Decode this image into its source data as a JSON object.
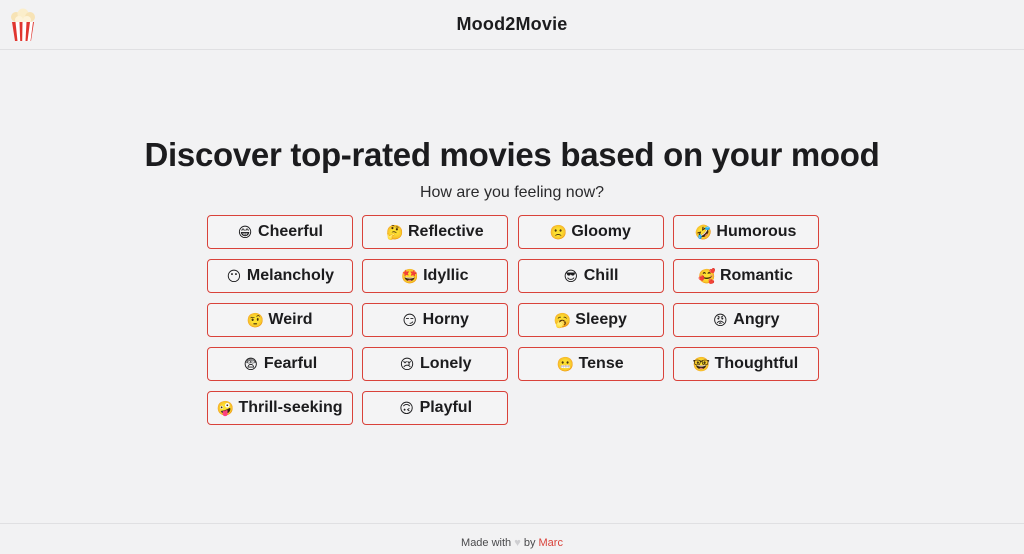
{
  "header": {
    "logo_icon": "popcorn-icon",
    "title": "Mood2Movie"
  },
  "main": {
    "headline": "Discover top-rated movies based on your mood",
    "subtitle": "How are you feeling now?",
    "moods": [
      {
        "emoji": "😁",
        "label": "Cheerful"
      },
      {
        "emoji": "🤔",
        "label": "Reflective"
      },
      {
        "emoji": "🙁",
        "label": "Gloomy"
      },
      {
        "emoji": "🤣",
        "label": "Humorous"
      },
      {
        "emoji": "😶",
        "label": "Melancholy"
      },
      {
        "emoji": "🤩",
        "label": "Idyllic"
      },
      {
        "emoji": "😎",
        "label": "Chill"
      },
      {
        "emoji": "🥰",
        "label": "Romantic"
      },
      {
        "emoji": "🤨",
        "label": "Weird"
      },
      {
        "emoji": "😏",
        "label": "Horny"
      },
      {
        "emoji": "🥱",
        "label": "Sleepy"
      },
      {
        "emoji": "😡",
        "label": "Angry"
      },
      {
        "emoji": "😨",
        "label": "Fearful"
      },
      {
        "emoji": "😢",
        "label": "Lonely"
      },
      {
        "emoji": "😬",
        "label": "Tense"
      },
      {
        "emoji": "🤓",
        "label": "Thoughtful"
      },
      {
        "emoji": "🤪",
        "label": "Thrill-seeking"
      },
      {
        "emoji": "🙃",
        "label": "Playful"
      }
    ]
  },
  "footer": {
    "made_with": "Made with",
    "heart": "♥",
    "by": "by",
    "author": "Marc"
  },
  "colors": {
    "accent": "#d9423a",
    "background": "#f2f2f3",
    "text": "#1c1c1e"
  }
}
